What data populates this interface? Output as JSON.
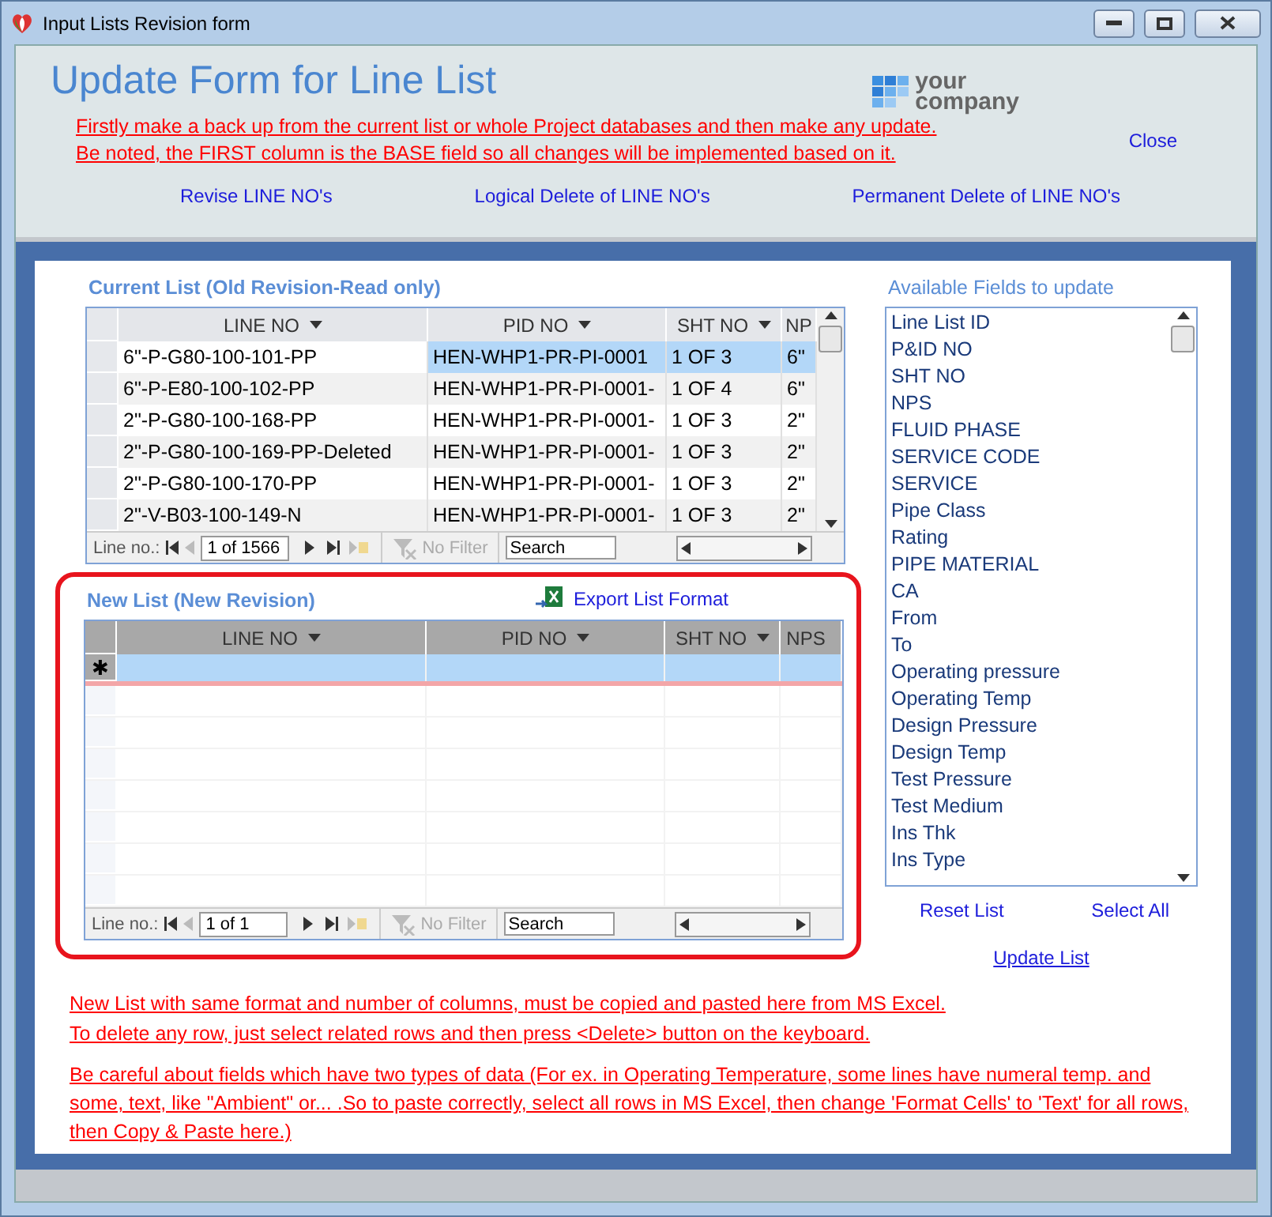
{
  "window": {
    "title": "Input Lists Revision form"
  },
  "header": {
    "title": "Update Form for Line List",
    "logo": {
      "line1": "your",
      "line2": "company"
    },
    "warnings": [
      "Firstly make a back up from the current list or whole Project databases and then make any update.",
      "Be noted, the FIRST column is the BASE field so all changes will be implemented based on it."
    ],
    "close": "Close",
    "actions": [
      "Revise LINE NO's",
      "Logical Delete of LINE NO's",
      "Permanent Delete of LINE NO's"
    ]
  },
  "current_list": {
    "title": "Current List (Old Revision-Read only)",
    "columns": [
      "LINE NO",
      "PID NO",
      "SHT NO",
      "NP"
    ],
    "rows": [
      {
        "cells": [
          "6\"-P-G80-100-101-PP",
          "HEN-WHP1-PR-PI-0001",
          "1 OF 3",
          "6\""
        ],
        "selected": true
      },
      {
        "cells": [
          "6\"-P-E80-100-102-PP",
          "HEN-WHP1-PR-PI-0001-",
          "1 OF 4",
          "6\""
        ],
        "selected": false
      },
      {
        "cells": [
          "2\"-P-G80-100-168-PP",
          "HEN-WHP1-PR-PI-0001-",
          "1 OF 3",
          "2\""
        ],
        "selected": false
      },
      {
        "cells": [
          "2\"-P-G80-100-169-PP-Deleted",
          "HEN-WHP1-PR-PI-0001-",
          "1 OF 3",
          "2\""
        ],
        "selected": false
      },
      {
        "cells": [
          "2\"-P-G80-100-170-PP",
          "HEN-WHP1-PR-PI-0001-",
          "1 OF 3",
          "2\""
        ],
        "selected": false
      },
      {
        "cells": [
          "2\"-V-B03-100-149-N",
          "HEN-WHP1-PR-PI-0001-",
          "1 OF 3",
          "2\""
        ],
        "selected": false
      }
    ],
    "nav": {
      "label": "Line no.:",
      "record": "1 of 1566",
      "filter": "No Filter",
      "search_placeholder": "Search"
    }
  },
  "new_list": {
    "title": "New List (New Revision)",
    "export": "Export List Format",
    "columns": [
      "LINE NO",
      "PID NO",
      "SHT NO",
      "NPS"
    ],
    "new_row_marker": "✱",
    "nav": {
      "label": "Line no.:",
      "record": "1 of 1",
      "filter": "No Filter",
      "search_placeholder": "Search"
    }
  },
  "fields": {
    "title": "Available Fields to update",
    "items": [
      "Line List ID",
      "P&ID NO",
      "SHT NO",
      "NPS",
      "FLUID PHASE",
      "SERVICE CODE",
      "SERVICE",
      "Pipe Class",
      "Rating",
      "PIPE MATERIAL",
      "CA",
      "From",
      "To",
      "Operating pressure",
      "Operating Temp",
      "Design Pressure",
      "Design Temp",
      "Test Pressure",
      "Test Medium",
      "Ins Thk",
      "Ins Type"
    ],
    "reset": "Reset List",
    "select_all": "Select All",
    "update": "Update List"
  },
  "notes": [
    "New List with same format and number of columns, must be copied and pasted here from MS Excel.",
    "To delete any row, just select related rows and then press <Delete> button on the keyboard.",
    "Be careful about fields which have two types of data (For ex. in Operating Temperature, some lines have numeral temp. and some, text, like \"Ambient\" or... .So to paste correctly, select all rows in MS Excel, then change 'Format Cells' to 'Text' for all rows, then Copy & Paste here.)"
  ]
}
